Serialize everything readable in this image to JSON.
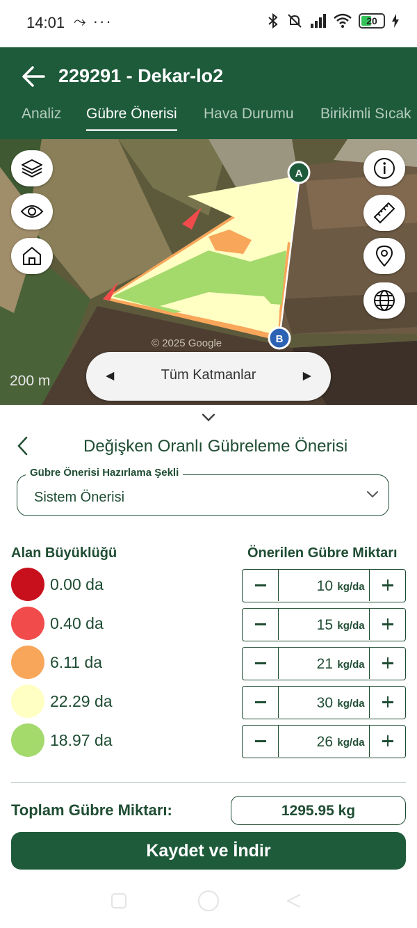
{
  "status_bar": {
    "time": "14:01",
    "extra": "⤳ ···",
    "battery": "20"
  },
  "header": {
    "title": "229291 - Dekar-lo2",
    "tabs": [
      {
        "label": "Analiz"
      },
      {
        "label": "Gübre Önerisi"
      },
      {
        "label": "Hava Durumu"
      },
      {
        "label": "Birikimli Sıcak"
      }
    ]
  },
  "map": {
    "scale": "200 m",
    "watermark": "© 2025 Google",
    "marker_a": "A",
    "marker_b": "B",
    "layer_selector": {
      "label": "Tüm Katmanlar",
      "prev": "◀",
      "next": "▶"
    },
    "left_buttons": [
      "layers-icon",
      "eye-icon",
      "home-icon"
    ],
    "right_buttons": [
      "info-icon",
      "ruler-icon",
      "location-pin-icon",
      "globe-icon"
    ]
  },
  "panel": {
    "title": "Değişken Oranlı Gübreleme Önerisi",
    "select": {
      "legend": "Gübre Önerisi Hazırlama Şekli",
      "value": "Sistem Önerisi"
    },
    "col_area": "Alan Büyüklüğü",
    "col_amount": "Önerilen Gübre Miktarı",
    "unit": "kg/da",
    "zones": [
      {
        "area": "0.00 da",
        "amount": "10",
        "color": "#c8101d"
      },
      {
        "area": "0.40 da",
        "amount": "15",
        "color": "#f24b4b"
      },
      {
        "area": "6.11 da",
        "amount": "21",
        "color": "#f8a65a"
      },
      {
        "area": "22.29 da",
        "amount": "30",
        "color": "#ffffc4"
      },
      {
        "area": "18.97 da",
        "amount": "26",
        "color": "#a4d96c"
      }
    ],
    "total_label": "Toplam Gübre Miktarı:",
    "total_value": "1295.95 kg",
    "save_label": "Kaydet ve İndir"
  },
  "colors": {
    "primary": "#1e5b3b",
    "text": "#1f4d33"
  }
}
